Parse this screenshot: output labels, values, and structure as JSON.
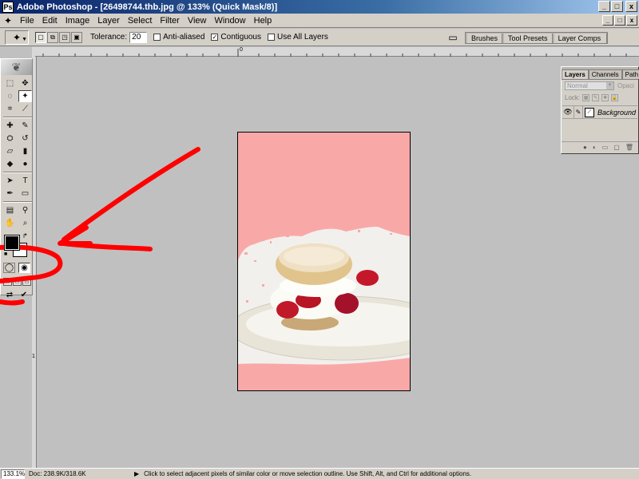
{
  "window": {
    "title": "Adobe Photoshop - [26498744.thb.jpg @ 133% (Quick Mask/8)]",
    "app_icon": "Ps",
    "buttons": [
      "_",
      "□",
      "x"
    ]
  },
  "menubar": {
    "icon": "magic-wand-icon",
    "items": [
      "File",
      "Edit",
      "Image",
      "Layer",
      "Select",
      "Filter",
      "View",
      "Window",
      "Help"
    ],
    "doc_buttons": [
      "_",
      "□",
      "x"
    ]
  },
  "options": {
    "tolerance_label": "Tolerance:",
    "tolerance_value": "20",
    "anti_aliased": {
      "label": "Anti-aliased",
      "checked": false
    },
    "contiguous": {
      "label": "Contiguous",
      "checked": true
    },
    "use_all_layers": {
      "label": "Use All Layers",
      "checked": false
    },
    "palette_well": [
      "Brushes",
      "Tool Presets",
      "Layer Comps"
    ]
  },
  "rulers": {
    "h_labels": [
      "0"
    ],
    "v_labels": [
      "1"
    ]
  },
  "toolbox": {
    "tools": [
      {
        "name": "marquee-tool",
        "glyph": "⬚"
      },
      {
        "name": "move-tool",
        "glyph": "✥"
      },
      {
        "name": "lasso-tool",
        "glyph": "◌"
      },
      {
        "name": "magic-wand-tool",
        "glyph": "✦",
        "active": true
      },
      {
        "name": "crop-tool",
        "glyph": "⌗"
      },
      {
        "name": "slice-tool",
        "glyph": "⟋"
      },
      {
        "name": "healing-brush-tool",
        "glyph": "✚"
      },
      {
        "name": "brush-tool",
        "glyph": "✎"
      },
      {
        "name": "clone-stamp-tool",
        "glyph": "⛭"
      },
      {
        "name": "history-brush-tool",
        "glyph": "↺"
      },
      {
        "name": "eraser-tool",
        "glyph": "▱"
      },
      {
        "name": "gradient-tool",
        "glyph": "▮"
      },
      {
        "name": "blur-tool",
        "glyph": "◆"
      },
      {
        "name": "dodge-tool",
        "glyph": "●"
      },
      {
        "name": "path-selection-tool",
        "glyph": "➤"
      },
      {
        "name": "type-tool",
        "glyph": "T"
      },
      {
        "name": "pen-tool",
        "glyph": "✒"
      },
      {
        "name": "shape-tool",
        "glyph": "▭"
      },
      {
        "name": "notes-tool",
        "glyph": "▤"
      },
      {
        "name": "eyedropper-tool",
        "glyph": "⚲"
      },
      {
        "name": "hand-tool",
        "glyph": "✋"
      },
      {
        "name": "zoom-tool",
        "glyph": "⌕"
      }
    ],
    "colors": {
      "foreground": "#000000",
      "background": "#ffffff"
    },
    "mode_buttons": [
      "standard-mode",
      "quick-mask-mode"
    ],
    "screen_buttons": [
      "standard-screen",
      "full-screen-menu",
      "full-screen"
    ],
    "jump_buttons": [
      "jump-to-imageready",
      "jump-icon"
    ]
  },
  "document": {
    "mask_color": "#f9a8a8",
    "photo_bg": "#f2f0ec"
  },
  "annotation": {
    "color": "#ff0000"
  },
  "layers": {
    "tabs": [
      "Layers",
      "Channels",
      "Path"
    ],
    "blend_mode": "Normal",
    "opacity_label": "Opaci",
    "lock_label": "Lock:",
    "layer_name": "Background",
    "bottom_buttons": [
      "link-layers",
      "new-fill-layer",
      "new-set",
      "new-layer",
      "delete-layer"
    ]
  },
  "status": {
    "zoom": "133.1%",
    "doc_size": "Doc: 238.9K/318.6K",
    "arrow": "▶",
    "message": "Click to select adjacent pixels of similar color or move selection outline.  Use Shift, Alt, and Ctrl for additional options."
  }
}
